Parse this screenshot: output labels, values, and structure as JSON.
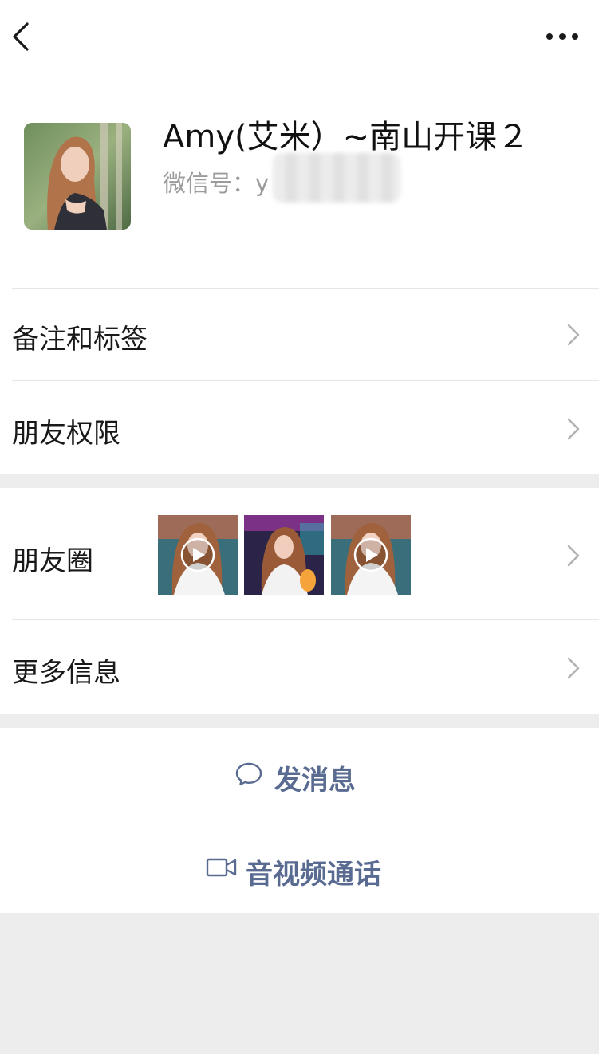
{
  "contact": {
    "name": "Amy(艾米）~南山开课２",
    "wechat_id_label": "微信号：y"
  },
  "cells": {
    "remark_tags": "备注和标签",
    "friend_permissions": "朋友权限",
    "moments": "朋友圈",
    "more_info": "更多信息"
  },
  "actions": {
    "send_message": "发消息",
    "video_call": "音视频通话"
  },
  "colors": {
    "background": "#ededed",
    "cell_bg": "#ffffff",
    "action_text": "#5a6b92",
    "secondary_text": "#9b9b9b"
  },
  "icons": [
    "back-icon",
    "more-icon",
    "chevron-right-icon",
    "chat-bubble-icon",
    "video-camera-icon",
    "play-icon"
  ]
}
